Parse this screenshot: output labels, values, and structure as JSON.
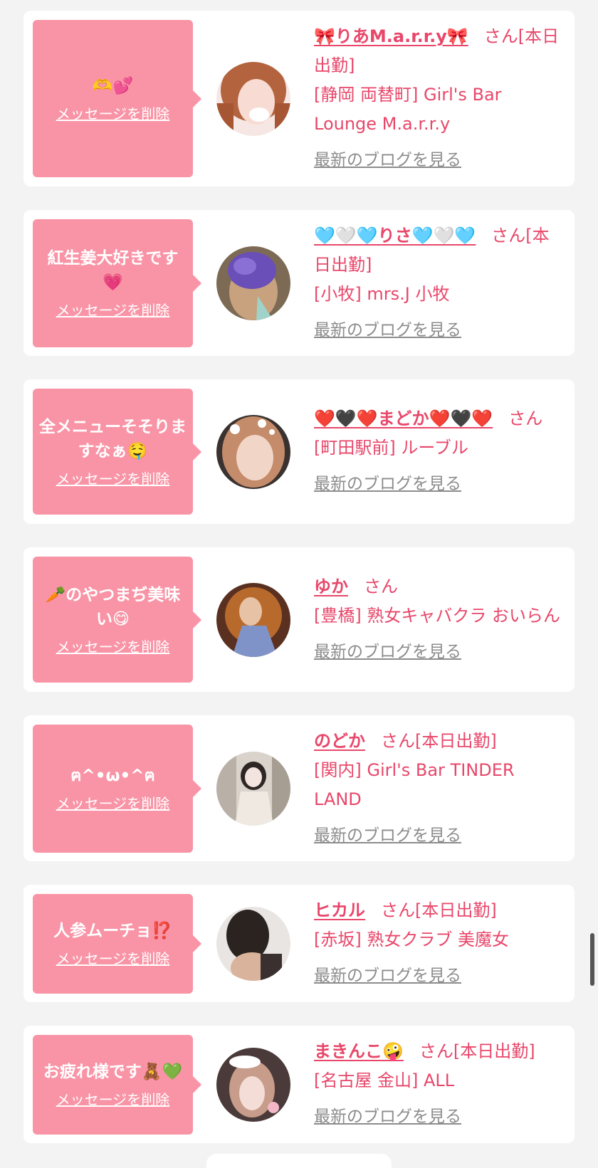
{
  "delete_label": "メッセージを削除",
  "blog_label": "最新のブログを見る",
  "colors": {
    "bubble": "#f994a6",
    "accent": "#e8476a",
    "link_gray": "#8c8c8c",
    "background": "#f3f3f3"
  },
  "cards": [
    {
      "message": "🫶💕",
      "name": "🎀りあM.a.r.r.y🎀",
      "suffix": "さん[本日出勤]",
      "shop": "[静岡 両替町] Girl's Bar Lounge M.a.r.r.y",
      "avatar_icon": "avatar-photo-icon"
    },
    {
      "message": "紅生姜大好きです💗",
      "name": "🩵🤍🩵りさ🩵🤍🩵",
      "suffix": "さん[本日出勤]",
      "shop": "[小牧] mrs.J 小牧",
      "avatar_icon": "avatar-photo-icon"
    },
    {
      "message": "全メニューそそりますなぁ🤤",
      "name": "❤️🖤❤️まどか❤️🖤❤️",
      "suffix": "さん",
      "shop": "[町田駅前] ルーブル",
      "avatar_icon": "avatar-photo-icon"
    },
    {
      "message": "🥕のやつまぢ美味い😋",
      "name": "ゆか",
      "suffix": "さん",
      "shop": "[豊橋] 熟女キャバクラ おいらん",
      "avatar_icon": "avatar-photo-icon"
    },
    {
      "message": "ฅ^•ω•^ฅ",
      "name": "のどか",
      "suffix": "さん[本日出勤]",
      "shop": "[関内] Girl's Bar TINDER LAND",
      "avatar_icon": "avatar-photo-icon"
    },
    {
      "message": "人参ムーチョ⁉️",
      "name": "ヒカル",
      "suffix": "さん[本日出勤]",
      "shop": "[赤坂] 熟女クラブ 美魔女",
      "avatar_icon": "avatar-photo-icon"
    },
    {
      "message": "お疲れ様です🧸💚",
      "name": "まきんこ🤪",
      "suffix": "さん[本日出勤]",
      "shop": "[名古屋 金山] ALL",
      "avatar_icon": "avatar-photo-icon"
    }
  ]
}
